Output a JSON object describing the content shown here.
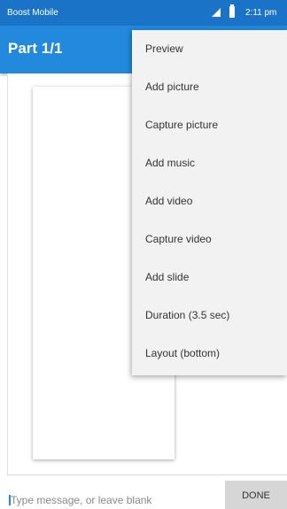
{
  "status_bar": {
    "carrier": "Boost Mobile",
    "time": "2:11 pm",
    "icons": [
      "signal-icon",
      "battery-icon"
    ]
  },
  "app_bar": {
    "title": "Part 1/1"
  },
  "menu": {
    "items": [
      {
        "label": "Preview"
      },
      {
        "label": "Add picture"
      },
      {
        "label": "Capture picture"
      },
      {
        "label": "Add music"
      },
      {
        "label": "Add video"
      },
      {
        "label": "Capture video"
      },
      {
        "label": "Add slide"
      },
      {
        "label": "Duration (3.5 sec)"
      },
      {
        "label": "Layout (bottom)"
      }
    ]
  },
  "compose": {
    "placeholder": "Type message, or leave blank",
    "value": "",
    "done_label": "DONE"
  },
  "colors": {
    "status_bar": "#1a73c6",
    "app_bar": "#2289dc",
    "menu_background": "#f2f2f2",
    "done_button": "#d6d6d6"
  }
}
